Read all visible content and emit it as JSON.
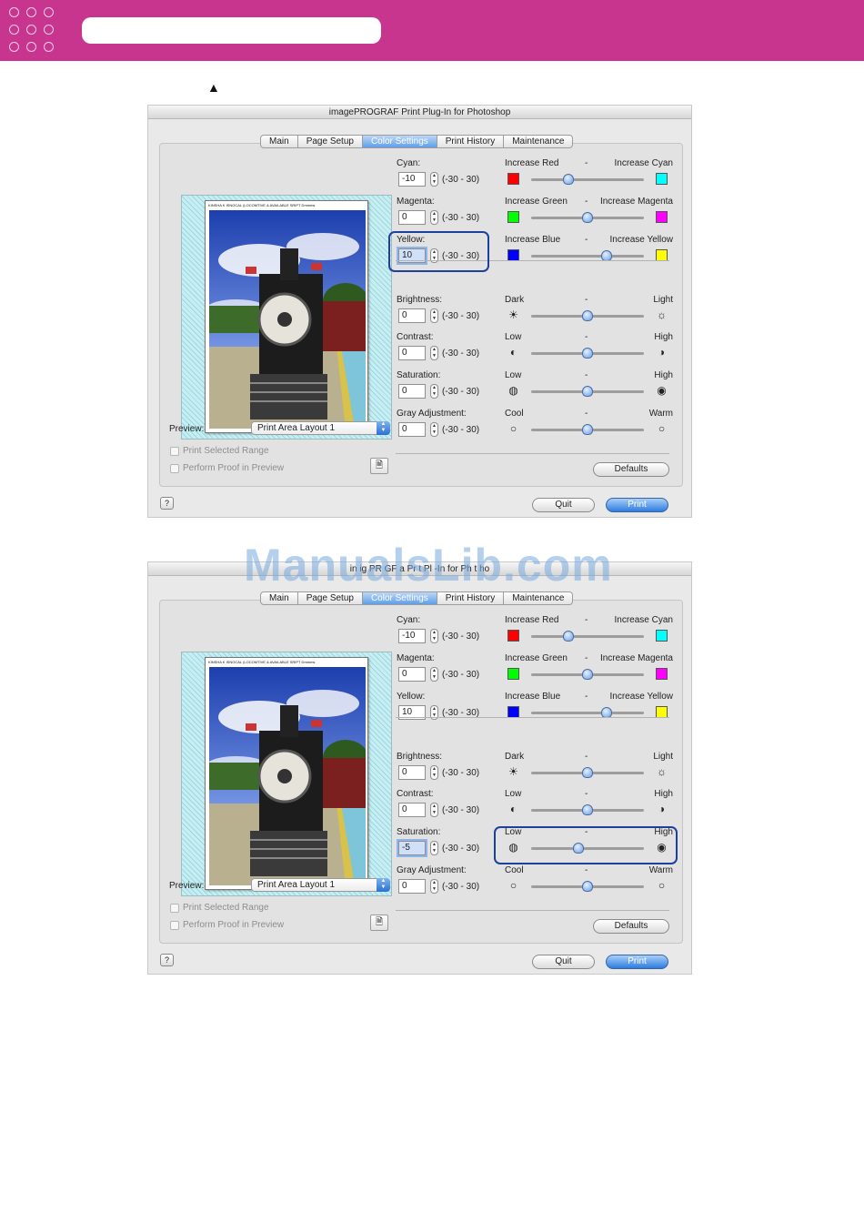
{
  "header": {
    "brand_color": "#c8358f"
  },
  "marker": "▲",
  "watermark": "ManualsLib.com",
  "dialog_title": "imagePROGRAF Print Plug-In for Photoshop",
  "dialog_title_partial": "in  ig PR  GF  a  Pr  t Pl  -In for Ph  t  ho",
  "tabs": [
    "Main",
    "Page Setup",
    "Color Settings",
    "Print History",
    "Maintenance"
  ],
  "active_tab": "Color Settings",
  "paper_header": "KINSHA  K  ISNOCAL  (LOCOMTIVE  &  AVAILABLE  SRIPT  Dmmms",
  "preview": {
    "label": "Preview:",
    "value": "Print Area Layout 1"
  },
  "options": {
    "print_selected_range": "Print Selected Range",
    "perform_proof": "Perform Proof in Preview"
  },
  "range_text": "(-30 - 30)",
  "mid_mark": "-",
  "buttons": {
    "defaults": "Defaults",
    "quit": "Quit",
    "print": "Print",
    "help": "?"
  },
  "colors": {
    "red": "#ff0000",
    "cyan": "#00ffff",
    "green": "#00ff00",
    "magenta": "#ff00ff",
    "blue": "#0000ff",
    "yellow": "#ffff00"
  },
  "dialogs": [
    {
      "sliders": [
        {
          "label": "Cyan:",
          "value": "-10",
          "left": "Increase Red",
          "right": "Increase Cyan",
          "level": -10
        },
        {
          "label": "Magenta:",
          "value": "0",
          "left": "Increase Green",
          "right": "Increase Magenta",
          "level": 0
        },
        {
          "label": "Yellow:",
          "value": "10",
          "left": "Increase Blue",
          "right": "Increase Yellow",
          "level": 10
        },
        {
          "label": "Brightness:",
          "value": "0",
          "left": "Dark",
          "right": "Light",
          "level": 0
        },
        {
          "label": "Contrast:",
          "value": "0",
          "left": "Low",
          "right": "High",
          "level": 0
        },
        {
          "label": "Saturation:",
          "value": "0",
          "left": "Low",
          "right": "High",
          "level": 0
        },
        {
          "label": "Gray Adjustment:",
          "value": "0",
          "left": "Cool",
          "right": "Warm",
          "level": 0
        }
      ],
      "highlighted": "Yellow"
    },
    {
      "sliders": [
        {
          "label": "Cyan:",
          "value": "-10",
          "left": "Increase Red",
          "right": "Increase Cyan",
          "level": -10
        },
        {
          "label": "Magenta:",
          "value": "0",
          "left": "Increase Green",
          "right": "Increase Magenta",
          "level": 0
        },
        {
          "label": "Yellow:",
          "value": "10",
          "left": "Increase Blue",
          "right": "Increase Yellow",
          "level": 10
        },
        {
          "label": "Brightness:",
          "value": "0",
          "left": "Dark",
          "right": "Light",
          "level": 0
        },
        {
          "label": "Contrast:",
          "value": "0",
          "left": "Low",
          "right": "High",
          "level": 0
        },
        {
          "label": "Saturation:",
          "value": "-5",
          "left": "Low",
          "right": "High",
          "level": -5
        },
        {
          "label": "Gray Adjustment:",
          "value": "0",
          "left": "Cool",
          "right": "Warm",
          "level": 0
        }
      ],
      "highlighted": "Saturation"
    }
  ]
}
